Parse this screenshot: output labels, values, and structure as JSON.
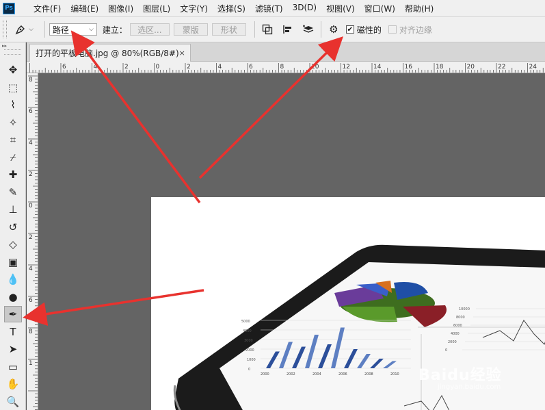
{
  "app": {
    "logo_text": "Ps"
  },
  "menu": [
    "文件(F)",
    "编辑(E)",
    "图像(I)",
    "图层(L)",
    "文字(Y)",
    "选择(S)",
    "滤镜(T)",
    "3D(D)",
    "视图(V)",
    "窗口(W)",
    "帮助(H)"
  ],
  "options": {
    "mode_select": "路径",
    "make_label": "建立：",
    "selection_btn": "选区...",
    "mask_btn": "蒙版",
    "shape_btn": "形状",
    "magnetic_label": "磁性的",
    "magnetic_checked": true,
    "align_edges_label": "对齐边缘",
    "align_edges_checked": false
  },
  "document": {
    "tab_title": "打开的平板电脑.jpg @ 80%(RGB/8#)",
    "close_glyph": "×"
  },
  "ruler_top_labels": [
    "6",
    "4",
    "2",
    "0",
    "2",
    "4",
    "6",
    "8",
    "10",
    "12",
    "14",
    "16",
    "18",
    "20",
    "22",
    "24"
  ],
  "ruler_left_labels": [
    "8",
    "6",
    "4",
    "2",
    "0",
    "2",
    "4",
    "6",
    "8",
    "1"
  ],
  "tools": [
    {
      "name": "move-tool-icon",
      "glyph": "✥"
    },
    {
      "name": "marquee-tool-icon",
      "glyph": "⬚"
    },
    {
      "name": "lasso-tool-icon",
      "glyph": "⌇"
    },
    {
      "name": "magic-wand-tool-icon",
      "glyph": "✧"
    },
    {
      "name": "crop-tool-icon",
      "glyph": "⌗"
    },
    {
      "name": "eyedropper-tool-icon",
      "glyph": "⌿"
    },
    {
      "name": "healing-brush-tool-icon",
      "glyph": "✚"
    },
    {
      "name": "brush-tool-icon",
      "glyph": "✎"
    },
    {
      "name": "clone-stamp-tool-icon",
      "glyph": "⊥"
    },
    {
      "name": "history-brush-tool-icon",
      "glyph": "↺"
    },
    {
      "name": "eraser-tool-icon",
      "glyph": "◇"
    },
    {
      "name": "gradient-tool-icon",
      "glyph": "▣"
    },
    {
      "name": "blur-tool-icon",
      "glyph": "💧"
    },
    {
      "name": "dodge-tool-icon",
      "glyph": "●"
    },
    {
      "name": "pen-tool-icon",
      "glyph": "✒",
      "active": true
    },
    {
      "name": "type-tool-icon",
      "glyph": "T"
    },
    {
      "name": "path-selection-tool-icon",
      "glyph": "➤"
    },
    {
      "name": "rectangle-tool-icon",
      "glyph": "▭"
    },
    {
      "name": "hand-tool-icon",
      "glyph": "✋"
    },
    {
      "name": "zoom-tool-icon",
      "glyph": "🔍"
    }
  ],
  "tablet_chart": {
    "y_ticks": [
      "5000",
      "4000",
      "3000",
      "2000",
      "1000",
      "0"
    ],
    "x_ticks": [
      "2000",
      "2002",
      "2004",
      "2006",
      "2008",
      "2010"
    ],
    "bars": [
      0.35,
      0.55,
      0.45,
      0.7,
      0.5,
      0.85,
      0.4,
      0.3,
      0.2,
      0.15
    ],
    "side_ticks": [
      "10000",
      "8000",
      "6000",
      "4000",
      "2000",
      "0"
    ]
  },
  "watermark": {
    "main": "Baidu经验",
    "sub": "jingyan.baidu.com"
  },
  "colors": {
    "arrow": "#e8322e",
    "accent": "#31a8ff"
  }
}
